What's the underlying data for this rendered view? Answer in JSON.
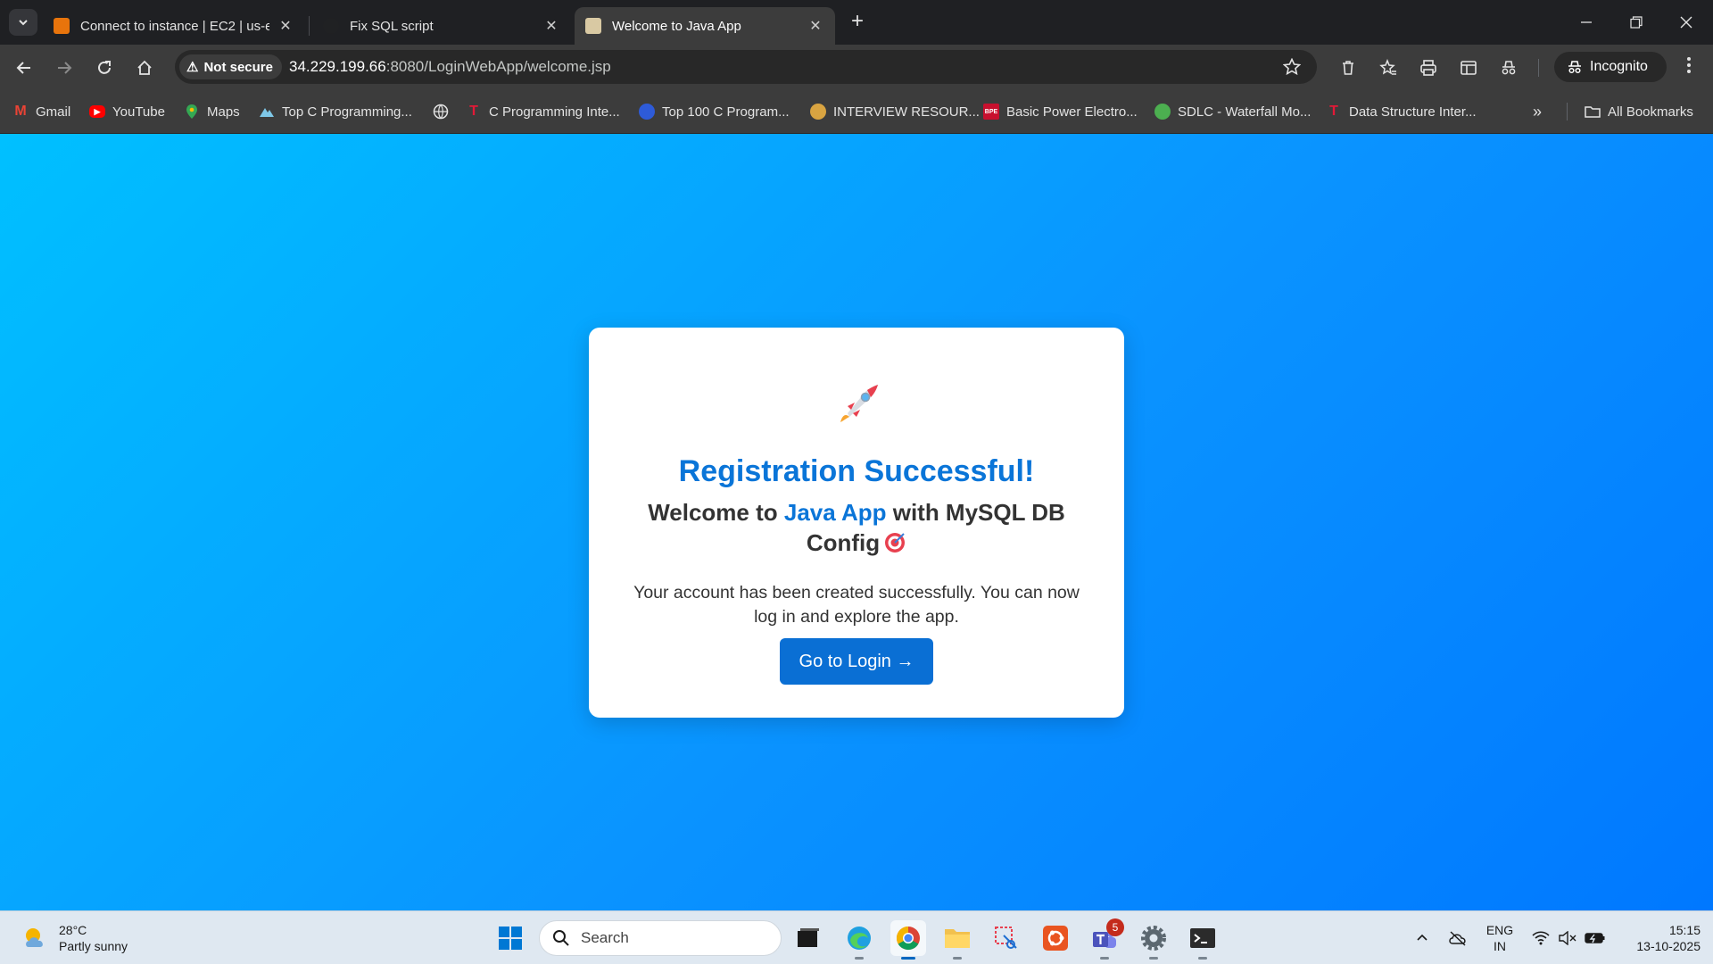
{
  "browser": {
    "tabs": [
      {
        "label": "Connect to instance | EC2 | us-e",
        "favicon": "aws-icon",
        "color": "#e8740c"
      },
      {
        "label": "Fix SQL script",
        "favicon": "chatgpt-icon",
        "color": "#202123"
      },
      {
        "label": "Welcome to Java App",
        "favicon": "java-app-icon",
        "color": "#d9c9a3",
        "active": true
      }
    ],
    "security_label": "Not secure",
    "url_host": "34.229.199.66",
    "url_path": ":8080/LoginWebApp/welcome.jsp",
    "profile_label": "Incognito",
    "bookmarks": [
      {
        "label": "Gmail",
        "icon": "gmail-icon"
      },
      {
        "label": "YouTube",
        "icon": "youtube-icon"
      },
      {
        "label": "Maps",
        "icon": "maps-icon"
      },
      {
        "label": "Top C Programming...",
        "icon": "mountain-icon"
      },
      {
        "label": "",
        "icon": "globe-icon"
      },
      {
        "label": "C Programming Inte...",
        "icon": "tesla-icon"
      },
      {
        "label": "Top 100 C Program...",
        "icon": "blue-logo-icon"
      },
      {
        "label": "INTERVIEW RESOUR...",
        "icon": "cat-icon"
      },
      {
        "label": "Basic Power Electro...",
        "icon": "red-book-icon"
      },
      {
        "label": "SDLC - Waterfall Mo...",
        "icon": "green-leaf-icon"
      },
      {
        "label": "Data Structure Inter...",
        "icon": "tesla-icon"
      }
    ],
    "all_bookmarks_label": "All Bookmarks"
  },
  "page": {
    "heading": "Registration Successful!",
    "welcome_prefix": "Welcome to ",
    "welcome_highlight": "Java App",
    "welcome_suffix": " with MySQL DB Config",
    "message": "Your account has been created successfully. You can now log in and explore the app.",
    "button_label": "Go to Login →",
    "colors": {
      "accent": "#0a75d8",
      "button": "#0a6fd4",
      "bg_start": "#00c0ff",
      "bg_end": "#0078ff"
    }
  },
  "taskbar": {
    "weather_temp": "28°C",
    "weather_desc": "Partly sunny",
    "search_placeholder": "Search",
    "teams_badge": "5",
    "lang_line1": "ENG",
    "lang_line2": "IN",
    "time": "15:15",
    "date": "13-10-2025"
  }
}
